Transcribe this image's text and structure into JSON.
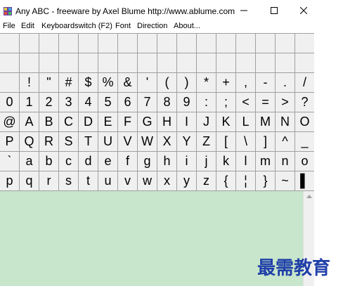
{
  "window": {
    "title": "Any ABC - freeware by Axel Blume http://www.ablume.com"
  },
  "menu": [
    "File",
    "Edit",
    "Keyboardswitch (F2)",
    "Font",
    "Direction",
    "About..."
  ],
  "grid": {
    "rows": [
      [
        "",
        "",
        "",
        "",
        "",
        "",
        "",
        "",
        "",
        "",
        "",
        "",
        "",
        "",
        "",
        ""
      ],
      [
        "",
        "",
        "",
        "",
        "",
        "",
        "",
        "",
        "",
        "",
        "",
        "",
        "",
        "",
        "",
        ""
      ],
      [
        "",
        "!",
        "\"",
        "#",
        "$",
        "%",
        "&",
        "'",
        "(",
        ")",
        "*",
        "+",
        ",",
        "-",
        ".",
        "/"
      ],
      [
        "0",
        "1",
        "2",
        "3",
        "4",
        "5",
        "6",
        "7",
        "8",
        "9",
        ":",
        ";",
        "<",
        "=",
        ">",
        "?"
      ],
      [
        "@",
        "A",
        "B",
        "C",
        "D",
        "E",
        "F",
        "G",
        "H",
        "I",
        "J",
        "K",
        "L",
        "M",
        "N",
        "O"
      ],
      [
        "P",
        "Q",
        "R",
        "S",
        "T",
        "U",
        "V",
        "W",
        "X",
        "Y",
        "Z",
        "[",
        "\\",
        "]",
        "^",
        "_"
      ],
      [
        "`",
        "a",
        "b",
        "c",
        "d",
        "e",
        "f",
        "g",
        "h",
        "i",
        "j",
        "k",
        "l",
        "m",
        "n",
        "o"
      ],
      [
        "p",
        "q",
        "r",
        "s",
        "t",
        "u",
        "v",
        "w",
        "x",
        "y",
        "z",
        "{",
        "¦",
        "}",
        "~",
        "▌"
      ]
    ]
  },
  "watermark": "最需教育",
  "colors": {
    "textarea_bg": "#c7e6cb",
    "cell_bg": "#f0f0f0",
    "grid_line": "#a0a0a0",
    "watermark": "#1f3fa8"
  }
}
